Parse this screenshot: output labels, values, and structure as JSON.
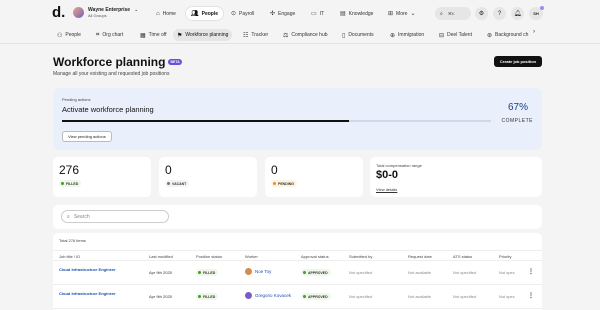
{
  "topnav": {
    "company_name": "Wayne Enterprise",
    "company_sub": "All Groups",
    "items": [
      {
        "label": "Home",
        "icon": "home-icon"
      },
      {
        "label": "People",
        "icon": "people-icon"
      },
      {
        "label": "Payroll",
        "icon": "payroll-icon"
      },
      {
        "label": "Engage",
        "icon": "engage-icon"
      },
      {
        "label": "IT",
        "icon": "laptop-icon"
      },
      {
        "label": "Knowledge",
        "icon": "book-icon"
      },
      {
        "label": "More",
        "icon": "grid-icon"
      }
    ],
    "search_shortcut": "⌘K",
    "user_initials": "SH"
  },
  "subnav": {
    "items": [
      {
        "label": "People"
      },
      {
        "label": "Org chart"
      },
      {
        "label": "Time off"
      },
      {
        "label": "Workforce planning"
      },
      {
        "label": "Tracker"
      },
      {
        "label": "Compliance hub"
      },
      {
        "label": "Documents"
      },
      {
        "label": "Immigration"
      },
      {
        "label": "Deel Talent"
      },
      {
        "label": "Background ch"
      }
    ]
  },
  "page": {
    "title": "Workforce planning",
    "badge": "BETA",
    "subtitle": "Manage all your existing and requested job positions",
    "create_button": "Create job position"
  },
  "banner": {
    "pending_label": "Pending actions",
    "title": "Activate workforce planning",
    "percent_text": "67%",
    "progress": 0.67,
    "complete_label": "COMPLETE",
    "view_button": "View pending actions"
  },
  "stats": {
    "filled": {
      "value": "276",
      "label": "FILLED"
    },
    "vacant": {
      "value": "0",
      "label": "VACANT"
    },
    "pending": {
      "value": "0",
      "label": "PENDING"
    },
    "compensation": {
      "label": "Total compensation range",
      "value": "$0-0",
      "link": "View details"
    }
  },
  "search": {
    "placeholder": "Search"
  },
  "table": {
    "total": "Total 276 items",
    "headers": [
      "Job title / ID",
      "Last modified",
      "Position status",
      "Worker",
      "Approval status",
      "Submitted by",
      "Request date",
      "ATS status",
      "Priority"
    ],
    "rows": [
      {
        "job": "Cloud Infrastructure Engineer",
        "modified": "Apr 9th 2025",
        "status": "FILLED",
        "worker": "Noe Toy",
        "approval": "APPROVED",
        "submitted": "Not specified",
        "request": "Not available",
        "ats": "Not specified",
        "priority": "Not spec"
      },
      {
        "job": "Cloud Infrastructure Engineer",
        "modified": "Apr 9th 2025",
        "status": "FILLED",
        "worker": "Gregorio Kovacek",
        "approval": "APPROVED",
        "submitted": "Not specified",
        "request": "Not available",
        "ats": "Not specified",
        "priority": "Not spec"
      }
    ]
  }
}
